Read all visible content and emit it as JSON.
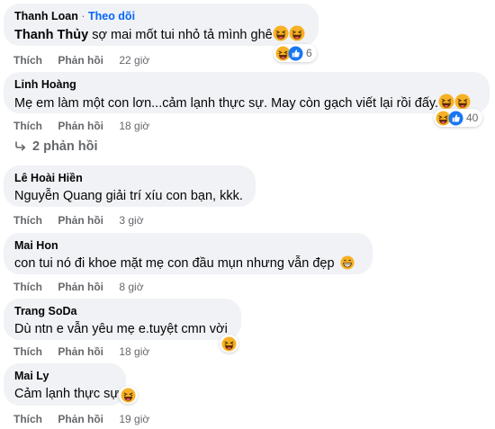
{
  "comments": [
    {
      "author": "Thanh Loan",
      "follow_separator": "·",
      "follow_label": "Theo dõi",
      "tag": "Thanh Thủy",
      "text": " sợ mai mốt tui nhỏ tả mình ghê",
      "like_label": "Thích",
      "reply_label": "Phản hồi",
      "time": "22 giờ",
      "reaction_count": "6"
    },
    {
      "author": "Linh Hoàng",
      "text": "Mẹ em làm một con lơn...cảm lạnh thực sự. May còn gạch viết lại rồi đấy.",
      "like_label": "Thích",
      "reply_label": "Phản hồi",
      "time": "18 giờ",
      "reaction_count": "40"
    },
    {
      "author": "Lê Hoài Hiền",
      "text": "Nguyễn Quang giải trí xíu con bạn, kkk.",
      "like_label": "Thích",
      "reply_label": "Phản hồi",
      "time": "3 giờ"
    },
    {
      "author": "Mai Hon",
      "text": "con tui nó đi khoe mặt mẹ con đầu mụn nhưng vẫn đẹp",
      "like_label": "Thích",
      "reply_label": "Phản hồi",
      "time": "8 giờ"
    },
    {
      "author": "Trang SoDa",
      "text": "Dù ntn e vẫn yêu mẹ e.tuyệt cmn vời",
      "like_label": "Thích",
      "reply_label": "Phản hồi",
      "time": "18 giờ"
    },
    {
      "author": "Mai Ly",
      "text": "Cảm lạnh thực sự",
      "like_label": "Thích",
      "reply_label": "Phản hồi",
      "time": "19 giờ"
    }
  ],
  "replies_label": "2 phản hồi",
  "colors": {
    "bubble": "#f0f2f5",
    "secondary_text": "#65676b",
    "link_blue": "#0866ff",
    "like_blue": "#1877f2",
    "haha_yellow": "#f7b125"
  }
}
